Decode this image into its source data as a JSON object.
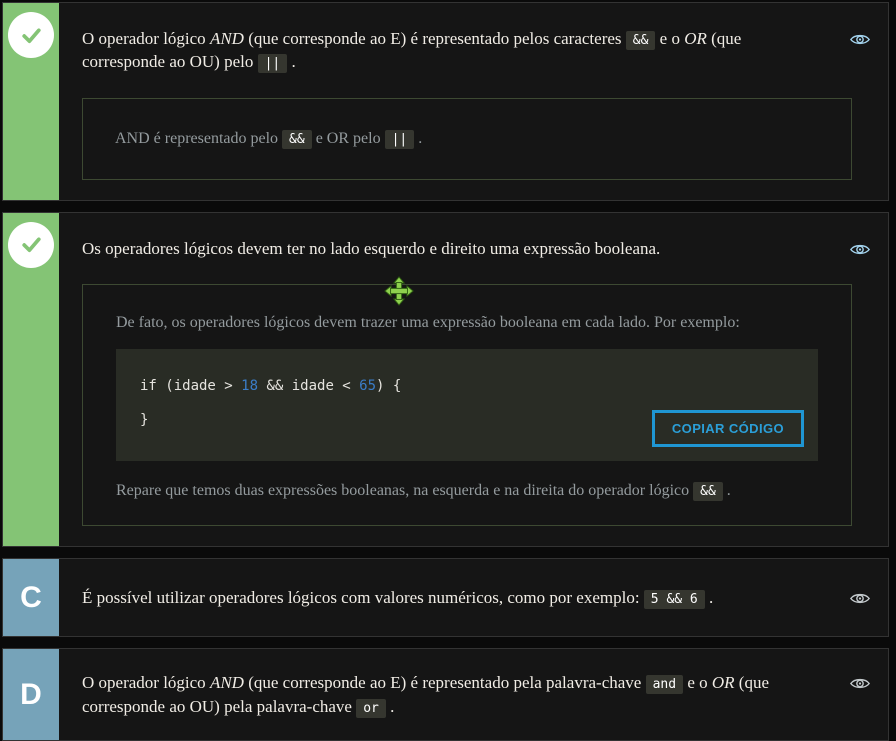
{
  "colors": {
    "correct_marker_green": "#84c475",
    "neutral_marker_blue": "#76a3b9",
    "eye_icon_blue": "#a3d2ec",
    "eye_icon_gray": "#c3c9cc",
    "copy_button_blue": "#2196d4",
    "code_number_blue": "#3b7dc8",
    "feedback_border_green": "#3d4932",
    "inline_code_bg": "#35362f",
    "code_block_bg": "#292c25"
  },
  "blocks": [
    {
      "state": "correct",
      "marker": "check",
      "title_segments": [
        {
          "t": "O operador lógico "
        },
        {
          "t": "AND",
          "k": "i"
        },
        {
          "t": " (que corresponde ao E) é representado pelos caracteres "
        },
        {
          "t": "&&",
          "k": "c"
        },
        {
          "t": " e o "
        },
        {
          "t": "OR",
          "k": "i"
        },
        {
          "t": " (que corresponde ao OU) pelo "
        },
        {
          "t": "||",
          "k": "c"
        },
        {
          "t": " ."
        }
      ],
      "feedback_segments": [
        {
          "t": "AND é representado pelo "
        },
        {
          "t": "&&",
          "k": "c"
        },
        {
          "t": " e OR pelo "
        },
        {
          "t": "||",
          "k": "c"
        },
        {
          "t": " ."
        }
      ]
    },
    {
      "state": "correct",
      "marker": "check",
      "title_segments": [
        {
          "t": "Os operadores lógicos devem ter no lado esquerdo e direito uma expressão booleana."
        }
      ],
      "feedback": {
        "intro_segments": [
          {
            "t": "De fato, os operadores lógicos devem trazer uma expressão booleana em cada lado. Por exemplo:"
          }
        ],
        "code_lines": [
          [
            {
              "t": "if (idade > "
            },
            {
              "t": "18",
              "k": "n"
            },
            {
              "t": " && idade < "
            },
            {
              "t": "65",
              "k": "n"
            },
            {
              "t": ") {"
            }
          ],
          [
            {
              "t": "}"
            }
          ]
        ],
        "copy_button_label": "COPIAR CÓDIGO",
        "outro_segments": [
          {
            "t": "Repare que temos duas expressões booleanas, na esquerda e na direita do operador lógico "
          },
          {
            "t": "&&",
            "k": "c"
          },
          {
            "t": " ."
          }
        ]
      }
    },
    {
      "state": "neutral",
      "marker": "C",
      "title_segments": [
        {
          "t": "É possível utilizar operadores lógicos com valores numéricos, como por exemplo: "
        },
        {
          "t": "5 && 6",
          "k": "c"
        },
        {
          "t": " ."
        }
      ]
    },
    {
      "state": "neutral",
      "marker": "D",
      "title_segments": [
        {
          "t": "O operador lógico "
        },
        {
          "t": "AND",
          "k": "i"
        },
        {
          "t": " (que corresponde ao E) é representado pela palavra-chave "
        },
        {
          "t": "and",
          "k": "c"
        },
        {
          "t": " e o "
        },
        {
          "t": "OR",
          "k": "i"
        },
        {
          "t": " (que corresponde ao OU) pela palavra-chave "
        },
        {
          "t": "or",
          "k": "c"
        },
        {
          "t": " ."
        }
      ]
    }
  ]
}
